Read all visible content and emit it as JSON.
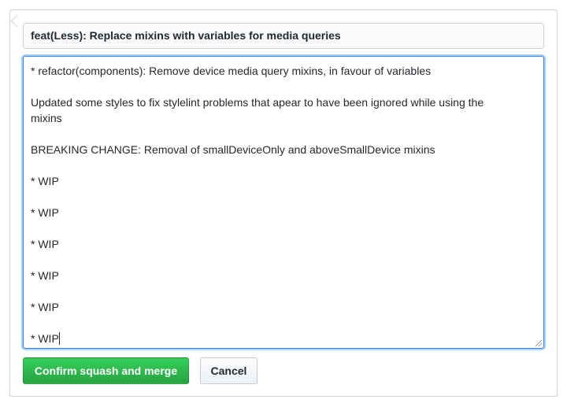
{
  "merge_form": {
    "commit_title": "feat(Less): Replace mixins with variables for media queries",
    "commit_message_lines": [
      "* refactor(components): Remove device media query mixins, in favour of variables",
      "",
      "Updated some styles to fix stylelint problems that apear to have been ignored while using the",
      "mixins",
      "",
      "BREAKING CHANGE: Removal of smallDeviceOnly and aboveSmallDevice mixins",
      "",
      "* WIP",
      "",
      "* WIP",
      "",
      "* WIP",
      "",
      "* WIP",
      "",
      "* WIP",
      "",
      "* WIP"
    ],
    "confirm_label": "Confirm squash and merge",
    "cancel_label": "Cancel"
  },
  "colors": {
    "focus_border": "#2188ff",
    "confirm_green": "#28a745",
    "text": "#24292e"
  }
}
